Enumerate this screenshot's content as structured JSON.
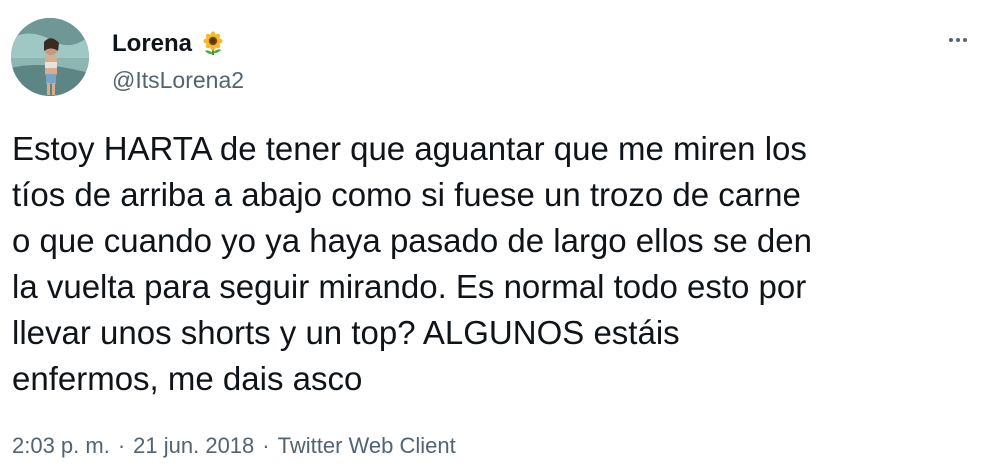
{
  "author": {
    "display_name": "Lorena",
    "emoji": "sunflower",
    "handle": "@ItsLorena2"
  },
  "tweet": {
    "text": "Estoy HARTA de tener que aguantar que me miren los\ntíos de arriba a abajo como si fuese un trozo de carne\no que cuando yo ya haya pasado de largo ellos se den\nla vuelta para seguir mirando. Es normal todo esto por\nllevar unos shorts y un top? ALGUNOS estáis\nenfermos, me dais asco"
  },
  "meta": {
    "time": "2:03 p. m.",
    "separator": "·",
    "date": "21 jun. 2018",
    "source": "Twitter Web Client"
  },
  "icons": {
    "more": "more-horizontal-icon",
    "emoji": "sunflower-icon"
  },
  "colors": {
    "text_primary": "#0f1419",
    "text_secondary": "#536471",
    "background": "#ffffff"
  }
}
